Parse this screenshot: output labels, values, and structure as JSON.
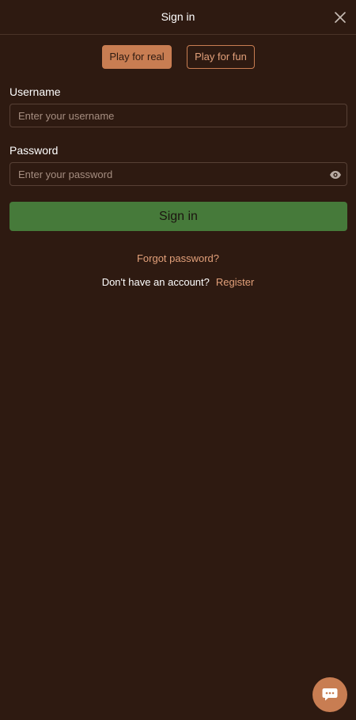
{
  "header": {
    "title": "Sign in",
    "close_icon": "close-icon"
  },
  "mode": {
    "selected": "real",
    "real_label": "Play for real",
    "fun_label": "Play for fun"
  },
  "form": {
    "username_label": "Username",
    "username_placeholder": "Enter your username",
    "username_value": "",
    "password_label": "Password",
    "password_placeholder": "Enter your password",
    "password_value": "",
    "show_password_icon": "eye-icon",
    "submit_label": "Sign in"
  },
  "links": {
    "forgot_password": "Forgot password?",
    "no_account_prompt": "Don't have an account?",
    "register": "Register"
  },
  "chat": {
    "icon": "chat-bubble-icon"
  },
  "colors": {
    "background": "#2e1a11",
    "accent": "#c87d52",
    "link": "#e2a07a",
    "primary_button": "#467a3a"
  }
}
